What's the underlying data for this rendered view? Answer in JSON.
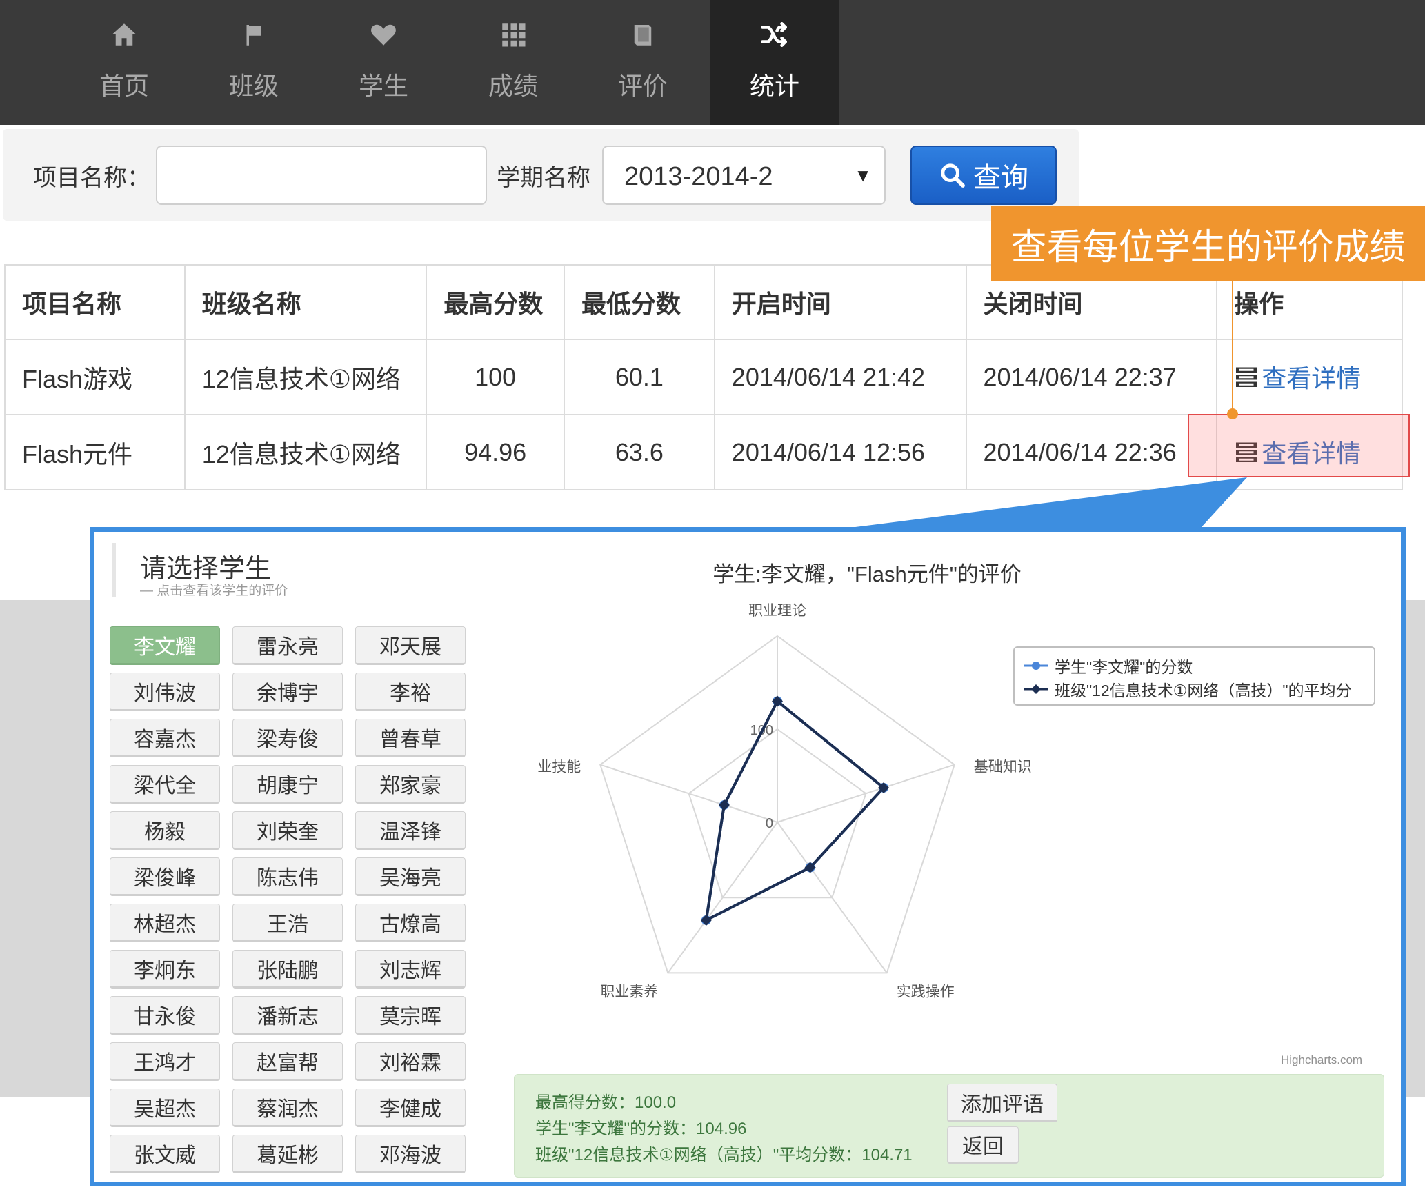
{
  "nav": {
    "items": [
      {
        "label": "首页",
        "icon": "home-icon"
      },
      {
        "label": "班级",
        "icon": "flag-icon"
      },
      {
        "label": "学生",
        "icon": "heart-icon"
      },
      {
        "label": "成绩",
        "icon": "grid-icon"
      },
      {
        "label": "评价",
        "icon": "book-icon"
      },
      {
        "label": "统计",
        "icon": "shuffle-icon"
      }
    ],
    "active": "统计"
  },
  "search": {
    "project_label": "项目名称：",
    "project_value": "",
    "term_label": "学期名称",
    "term_value": "2013-2014-2",
    "query_label": "查询"
  },
  "table": {
    "headers": [
      "项目名称",
      "班级名称",
      "最高分数",
      "最低分数",
      "开启时间",
      "关闭时间",
      "操作"
    ],
    "rows": [
      {
        "project": "Flash游戏",
        "class": "12信息技术①网络",
        "max": "100",
        "min": "60.1",
        "open": "2014/06/14 21:42",
        "close": "2014/06/14 22:37",
        "action": "查看详情"
      },
      {
        "project": "Flash元件",
        "class": "12信息技术①网络",
        "max": "94.96",
        "min": "63.6",
        "open": "2014/06/14 12:56",
        "close": "2014/06/14 22:36",
        "action": "查看详情"
      }
    ]
  },
  "callout": {
    "text": "查看每位学生的评价成绩"
  },
  "popup": {
    "title": "请选择学生",
    "subtitle": "— 点击查看该学生的评价",
    "students": [
      "李文耀",
      "雷永亮",
      "邓天展",
      "刘伟波",
      "余博宇",
      "李裕",
      "容嘉杰",
      "梁寿俊",
      "曾春草",
      "梁代全",
      "胡康宁",
      "郑家豪",
      "杨毅",
      "刘荣奎",
      "温泽锋",
      "梁俊峰",
      "陈志伟",
      "吴海亮",
      "林超杰",
      "王浩",
      "古燎高",
      "李炯东",
      "张陆鹏",
      "刘志辉",
      "甘永俊",
      "潘新志",
      "莫宗晖",
      "王鸿才",
      "赵富帮",
      "刘裕霖",
      "吴超杰",
      "蔡润杰",
      "李健成",
      "张文威",
      "葛延彬",
      "邓海波"
    ],
    "selected_student": "李文耀",
    "info": {
      "line1": "最高得分数：100.0",
      "line2": "学生\"李文耀\"的分数：104.96",
      "line3": "班级\"12信息技术①网络（高技）\"平均分数：104.71"
    },
    "buttons": {
      "add_comment": "添加评语",
      "back": "返回"
    }
  },
  "chart_data": {
    "type": "radar",
    "title": "学生:李文耀，\"Flash元件\"的评价",
    "categories": [
      "职业理论",
      "基础知识",
      "实践操作",
      "职业素养",
      "业技能"
    ],
    "radial_ticks": [
      "0",
      "100"
    ],
    "rlim": [
      0,
      200
    ],
    "series": [
      {
        "name": "学生\"李文耀\"的分数",
        "color": "#4a86d9",
        "values": [
          130,
          120,
          60,
          130,
          60
        ]
      },
      {
        "name": "班级\"12信息技术①网络（高技）\"的平均分",
        "color": "#1c2e52",
        "values": [
          130,
          120,
          60,
          130,
          60
        ]
      }
    ],
    "legend_position": "top-right",
    "credit": "Highcharts.com",
    "grid": true
  }
}
